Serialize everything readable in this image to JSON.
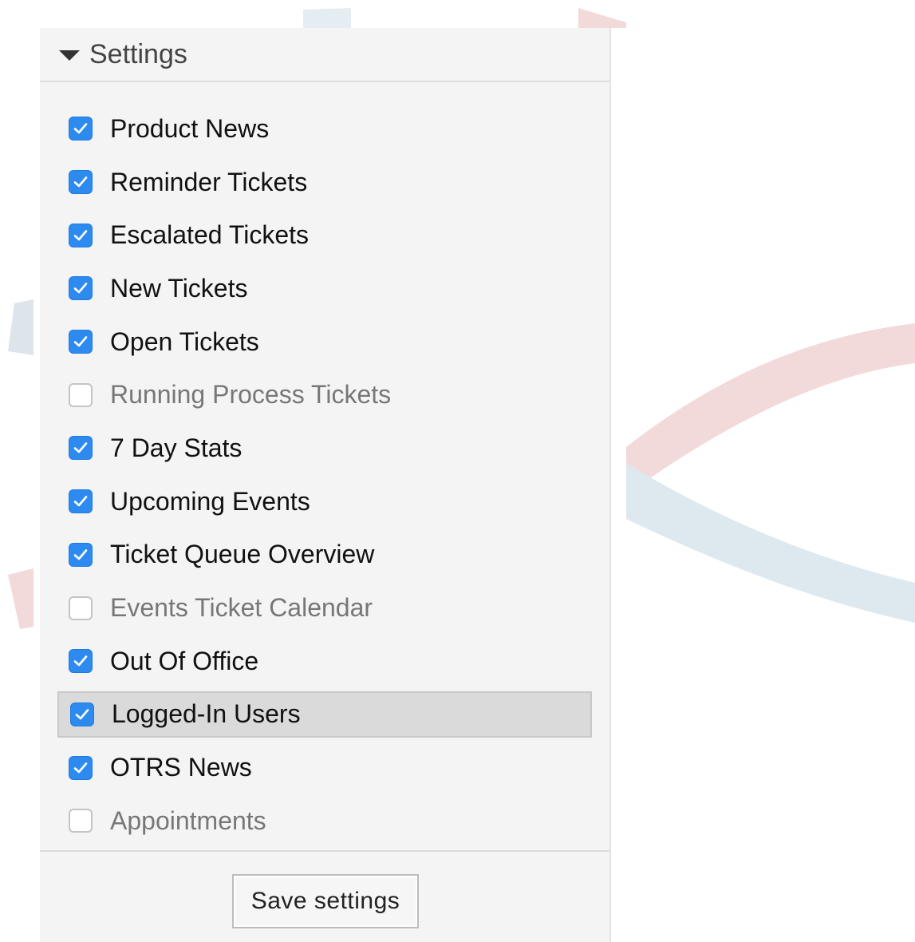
{
  "settings": {
    "title": "Settings",
    "items": [
      {
        "label": "Product News",
        "checked": true
      },
      {
        "label": "Reminder Tickets",
        "checked": true
      },
      {
        "label": "Escalated Tickets",
        "checked": true
      },
      {
        "label": "New Tickets",
        "checked": true
      },
      {
        "label": "Open Tickets",
        "checked": true
      },
      {
        "label": "Running Process Tickets",
        "checked": false
      },
      {
        "label": "7 Day Stats",
        "checked": true
      },
      {
        "label": "Upcoming Events",
        "checked": true
      },
      {
        "label": "Ticket Queue Overview",
        "checked": true
      },
      {
        "label": "Events Ticket Calendar",
        "checked": false
      },
      {
        "label": "Out Of Office",
        "checked": true
      },
      {
        "label": "Logged-In Users",
        "checked": true,
        "highlighted": true
      },
      {
        "label": "OTRS News",
        "checked": true
      },
      {
        "label": "Appointments",
        "checked": false
      }
    ],
    "save_label": "Save settings"
  },
  "colors": {
    "checkbox_checked": "#2d8bf0",
    "panel_background": "#f4f4f4",
    "highlight_row": "#dadada",
    "decor_red": "#f3dada",
    "decor_blue": "#dde9ee"
  },
  "icons": {
    "collapse": "caret-down-icon",
    "check": "checkmark-icon"
  }
}
